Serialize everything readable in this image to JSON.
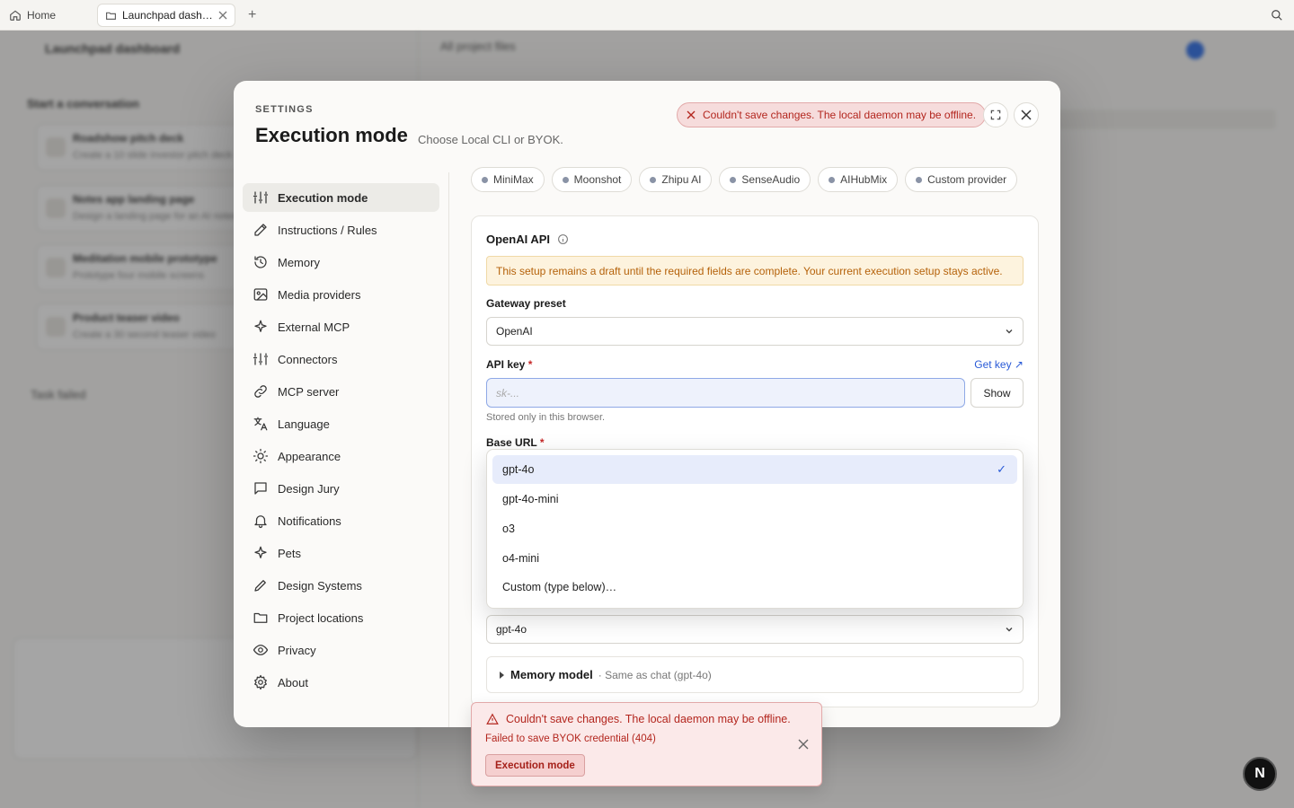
{
  "browser": {
    "home_label": "Home",
    "tab_label": "Launchpad dash…",
    "plus": "+"
  },
  "background": {
    "title": "Launchpad dashboard",
    "section": "Start a conversation",
    "cards": [
      {
        "title": "Roadshow pitch deck",
        "sub": "Create a 10 slide investor pitch deck"
      },
      {
        "title": "Notes app landing page",
        "sub": "Design a landing page for an AI notes app"
      },
      {
        "title": "Meditation mobile prototype",
        "sub": "Prototype four mobile screens"
      },
      {
        "title": "Product teaser video",
        "sub": "Create a 30 second teaser video"
      }
    ],
    "task": "Task failed",
    "tabs": "All project files"
  },
  "modal": {
    "eyebrow": "SETTINGS",
    "title": "Execution mode",
    "subtitle": "Choose Local CLI or BYOK.",
    "error_pill": "Couldn't save changes. The local daemon may be offline."
  },
  "sidebar": {
    "items": [
      {
        "label": "Execution mode",
        "icon": "sliders-icon"
      },
      {
        "label": "Instructions / Rules",
        "icon": "edit-icon"
      },
      {
        "label": "Memory",
        "icon": "history-icon"
      },
      {
        "label": "Media providers",
        "icon": "image-icon"
      },
      {
        "label": "External MCP",
        "icon": "sparkle-icon"
      },
      {
        "label": "Connectors",
        "icon": "sliders-icon"
      },
      {
        "label": "MCP server",
        "icon": "link-icon"
      },
      {
        "label": "Language",
        "icon": "translate-icon"
      },
      {
        "label": "Appearance",
        "icon": "sun-icon"
      },
      {
        "label": "Design Jury",
        "icon": "chat-icon"
      },
      {
        "label": "Notifications",
        "icon": "bell-icon"
      },
      {
        "label": "Pets",
        "icon": "sparkle-icon"
      },
      {
        "label": "Design Systems",
        "icon": "pen-icon"
      },
      {
        "label": "Project locations",
        "icon": "folder-icon"
      },
      {
        "label": "Privacy",
        "icon": "eye-icon"
      },
      {
        "label": "About",
        "icon": "gear-icon"
      }
    ]
  },
  "providers": [
    "MiniMax",
    "Moonshot",
    "Zhipu AI",
    "SenseAudio",
    "AIHubMix",
    "Custom provider"
  ],
  "form": {
    "card_title": "OpenAI API",
    "warning": "This setup remains a draft until the required fields are complete. Your current execution setup stays active.",
    "gateway_label": "Gateway preset",
    "gateway_value": "OpenAI",
    "apikey_label": "API key",
    "required_mark": "*",
    "get_key": "Get key ↗",
    "apikey_placeholder": "sk-...",
    "show_button": "Show",
    "apikey_hint": "Stored only in this browser.",
    "baseurl_label": "Base URL",
    "model_value": "gpt-4o",
    "memory_model_label": "Memory model",
    "memory_model_sub": "· Same as chat (gpt-4o)"
  },
  "dropdown": {
    "options": [
      "gpt-4o",
      "gpt-4o-mini",
      "o3",
      "o4-mini",
      "Custom (type below)…"
    ],
    "selected": "gpt-4o",
    "check": "✓"
  },
  "toast": {
    "title": "Couldn't save changes. The local daemon may be offline.",
    "detail": "Failed to save BYOK credential (404)",
    "action": "Execution mode"
  },
  "badge": "N",
  "colors": {
    "accent": "#2a5bd7",
    "error": "#b3261e",
    "warning": "#b5620a"
  }
}
